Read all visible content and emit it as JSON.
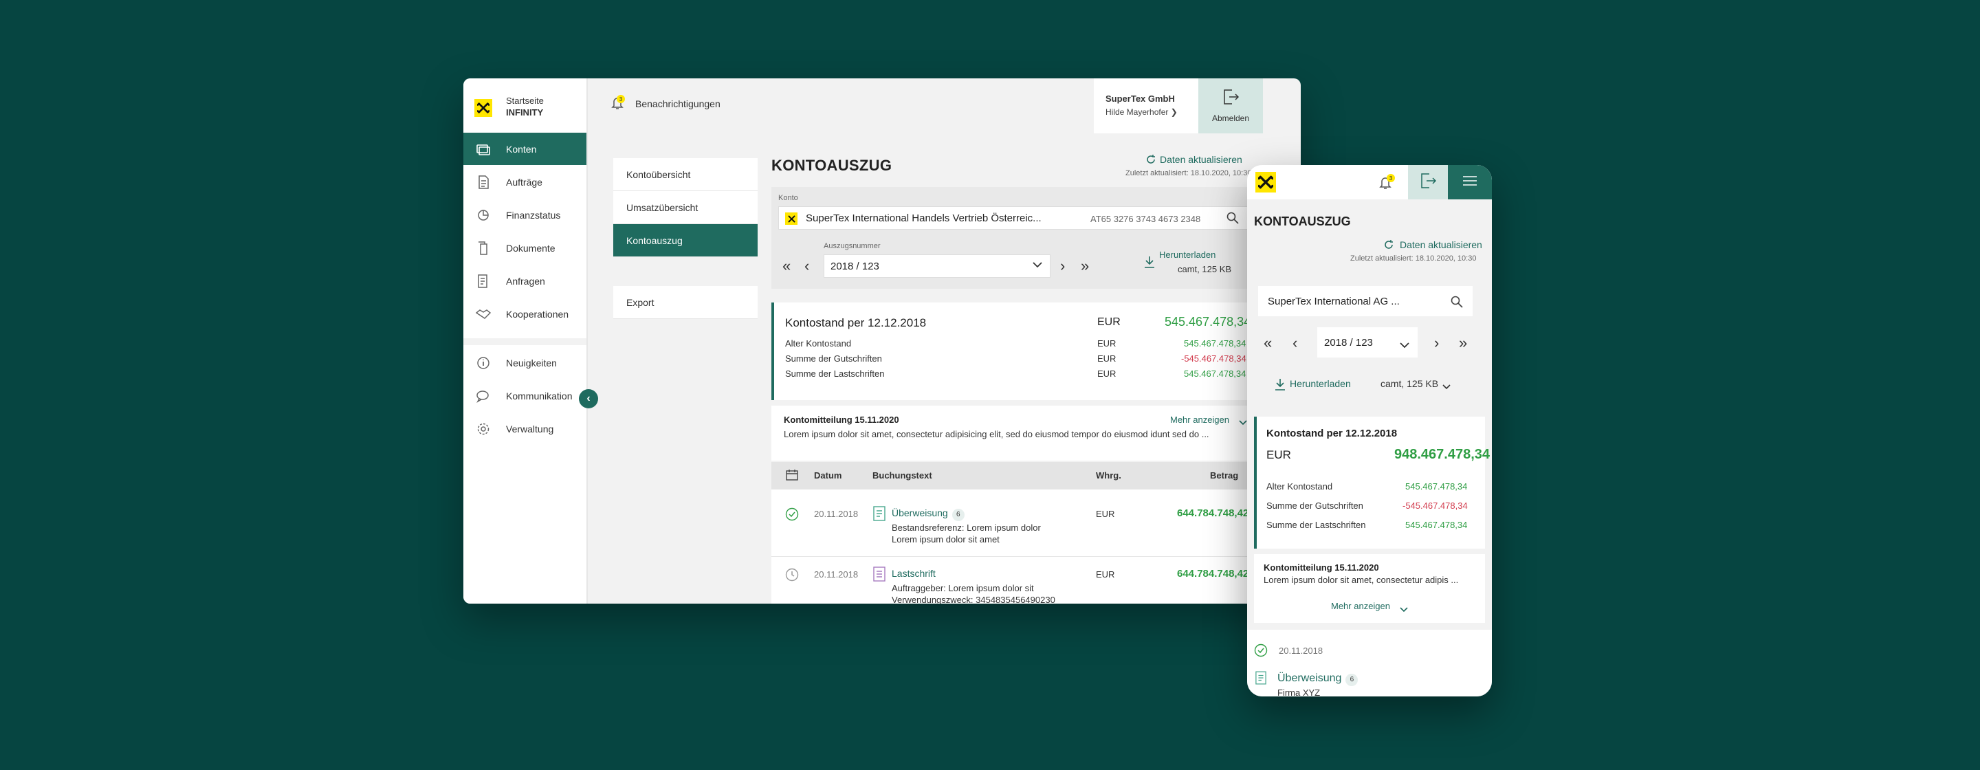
{
  "desktop": {
    "brand": {
      "line1": "Startseite",
      "line2": "INFINITY"
    },
    "nav_primary": [
      {
        "label": "Konten",
        "icon": "accounts-icon",
        "active": true
      },
      {
        "label": "Aufträge",
        "icon": "orders-icon"
      },
      {
        "label": "Finanzstatus",
        "icon": "finance-icon"
      },
      {
        "label": "Dokumente",
        "icon": "documents-icon"
      },
      {
        "label": "Anfragen",
        "icon": "requests-icon"
      },
      {
        "label": "Kooperationen",
        "icon": "handshake-icon"
      }
    ],
    "nav_secondary": [
      {
        "label": "Neuigkeiten",
        "icon": "info-icon"
      },
      {
        "label": "Kommunikation",
        "icon": "chat-icon"
      },
      {
        "label": "Verwaltung",
        "icon": "gear-icon"
      }
    ],
    "topbar": {
      "notifications_label": "Benachrichtigungen",
      "notifications_count": "3",
      "company": "SuperTex GmbH",
      "user": "Hilde Mayerhofer ❯",
      "logout_label": "Abmelden"
    },
    "subnav": [
      "Kontoübersicht",
      "Umsatzübersicht",
      "Kontoauszug"
    ],
    "subnav_export": "Export",
    "page_title": "KONTOAUSZUG",
    "refresh_label": "Daten aktualisieren",
    "last_updated": "Zuletzt aktualisiert: 18.10.2020, 10:30",
    "konto": {
      "label": "Konto",
      "name": "SuperTex International Handels Vertrieb Österreic...",
      "iban": "AT65 3276 3743 4673 2348"
    },
    "auszug": {
      "label": "Auszugsnummer",
      "value": "2018 / 123",
      "download_label": "Herunterladen",
      "file_info": "camt, 125 KB"
    },
    "kontostand": {
      "title": "Kontostand per 12.12.2018",
      "currency": "EUR",
      "total": "545.467.478,34",
      "rows": [
        {
          "label": "Alter Kontostand",
          "currency": "EUR",
          "value": "545.467.478,34",
          "sign": "pos"
        },
        {
          "label": "Summe der Gutschriften",
          "currency": "EUR",
          "value": "-545.467.478,34",
          "sign": "neg"
        },
        {
          "label": "Summe der Lastschriften",
          "currency": "EUR",
          "value": "545.467.478,34",
          "sign": "pos"
        }
      ]
    },
    "message": {
      "title": "Kontomitteilung 15.11.2020",
      "body": "Lorem ipsum dolor sit amet, consectetur adipisicing elit, sed do eiusmod tempor do eiusmod idunt sed do ...",
      "more_label": "Mehr anzeigen"
    },
    "table": {
      "headers": {
        "date": "Datum",
        "text": "Buchungstext",
        "currency": "Whrg.",
        "amount": "Betrag"
      },
      "rows": [
        {
          "date": "20.11.2018",
          "type": "Überweisung",
          "badge": "6",
          "line1": "Bestandsreferenz: Lorem ipsum dolor",
          "line2": "Lorem ipsum dolor sit amet",
          "currency": "EUR",
          "amount": "644.784.748,42"
        },
        {
          "date": "20.11.2018",
          "type": "Lastschrift",
          "badge": "",
          "line1": "Auftraggeber: Lorem ipsum dolor sit",
          "line2": "Verwendungszweck: 3454835456490230",
          "currency": "EUR",
          "amount": "644.784.748,42"
        }
      ]
    }
  },
  "mobile": {
    "notifications_count": "3",
    "page_title": "KONTOAUSZUG",
    "refresh_label": "Daten aktualisieren",
    "last_updated": "Zuletzt aktualisiert: 18.10.2020, 10:30",
    "konto_name": "SuperTex International AG ...",
    "auszug_value": "2018 / 123",
    "download_label": "Herunterladen",
    "file_info": "camt, 125 KB",
    "kontostand_title": "Kontostand per 12.12.2018",
    "currency": "EUR",
    "total": "948.467.478,34",
    "rows": [
      {
        "label": "Alter Kontostand",
        "value": "545.467.478,34",
        "sign": "pos"
      },
      {
        "label": "Summe der Gutschriften",
        "value": "-545.467.478,34",
        "sign": "neg"
      },
      {
        "label": "Summe der Lastschriften",
        "value": "545.467.478,34",
        "sign": "pos"
      }
    ],
    "message_title": "Kontomitteilung 15.11.2020",
    "message_body": "Lorem ipsum dolor sit amet, consectetur adipis ...",
    "more_label": "Mehr anzeigen",
    "tx_date": "20.11.2018",
    "tx_type": "Überweisung",
    "tx_badge": "6",
    "tx_sub": "Firma XYZ"
  },
  "colors": {
    "accent": "#1f6b5f",
    "brand_yellow": "#ffe600",
    "positive": "#2f9e44",
    "negative": "#d23b4d",
    "background": "#064541"
  }
}
